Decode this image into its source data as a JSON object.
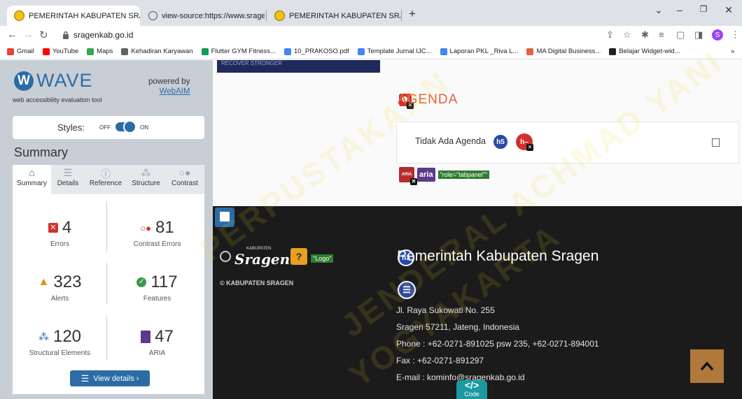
{
  "browser": {
    "tabs": [
      {
        "title": "PEMERINTAH KABUPATEN SRAGI",
        "close": "×"
      },
      {
        "title": "view-source:https://www.sragenk",
        "close": "×"
      },
      {
        "title": "PEMERINTAH KABUPATEN SRAGI",
        "close": "×"
      }
    ],
    "new_tab": "+",
    "window_controls": {
      "minimize": "–",
      "maximize": "❐",
      "close": "✕"
    },
    "dropdown": "⌄",
    "url": "sragenkab.go.id",
    "profile_initial": "S"
  },
  "bookmarks": [
    {
      "label": "Gmail",
      "color": "#ea4335"
    },
    {
      "label": "YouTube",
      "color": "#ff0000"
    },
    {
      "label": "Maps",
      "color": "#34a853"
    },
    {
      "label": "Kehadiran Karyawan",
      "color": "#5f6368"
    },
    {
      "label": "Flutter GYM Fitness...",
      "color": "#0f9d58"
    },
    {
      "label": "10_PRAKOSO.pdf",
      "color": "#4285f4"
    },
    {
      "label": "Template Jurnal IJC...",
      "color": "#4285f4"
    },
    {
      "label": "Laporan PKL _Riva L...",
      "color": "#4285f4"
    },
    {
      "label": "MA Digital Business...",
      "color": "#e8603c"
    },
    {
      "label": "Belajar Widget-wid...",
      "color": "#202124"
    }
  ],
  "bookmarks_more": "»",
  "wave": {
    "logo_letter": "W",
    "logo_word": "WAVE",
    "tagline": "web accessibility evaluation tool",
    "powered_by": "powered by",
    "webaim": "WebAIM",
    "styles_label": "Styles:",
    "styles_off": "OFF",
    "styles_on": "ON",
    "summary_heading": "Summary",
    "tabs": [
      "Summary",
      "Details",
      "Reference",
      "Structure",
      "Contrast"
    ],
    "stats": {
      "errors": {
        "value": "4",
        "label": "Errors"
      },
      "contrast": {
        "value": "81",
        "label": "Contrast Errors"
      },
      "alerts": {
        "value": "323",
        "label": "Alerts"
      },
      "features": {
        "value": "117",
        "label": "Features"
      },
      "structural": {
        "value": "120",
        "label": "Structural Elements"
      },
      "aria": {
        "value": "47",
        "label": "ARIA"
      }
    },
    "view_details": "View details ›"
  },
  "page": {
    "banner_text": "RECOVER STRONGER",
    "agenda_title": "AGENDA",
    "no_agenda": "Tidak Ada Agenda",
    "h5": "h5",
    "aria_label": "aria",
    "aria_small": "ARIA",
    "tabpanel_tag": "\"role=\"tabpanel\"\"",
    "footer": {
      "sragen_small": "KABUPATEN",
      "sragen_logo": "Sragen",
      "logo_alt": "\"Logo\"",
      "copyright": "© KABUPATEN SRAGEN",
      "h3": "h3",
      "title": "Pemerintah Kabupaten Sragen",
      "address": "Jl. Raya Sukowati No. 255",
      "city": "Sragen 57211, Jateng, Indonesia",
      "phone": "Phone : +62-0271-891025 psw 235, +62-0271-894001",
      "fax": "Fax : +62-0271-891297",
      "email": "E-mail : kominfo@sragenkab.go.id"
    },
    "code_button": "Code",
    "code_glyph": "</>",
    "watermark": [
      "PERPUSTAKAAN",
      "JENDERAL ACHMAD YANI",
      "YOGYAKARTA"
    ]
  }
}
